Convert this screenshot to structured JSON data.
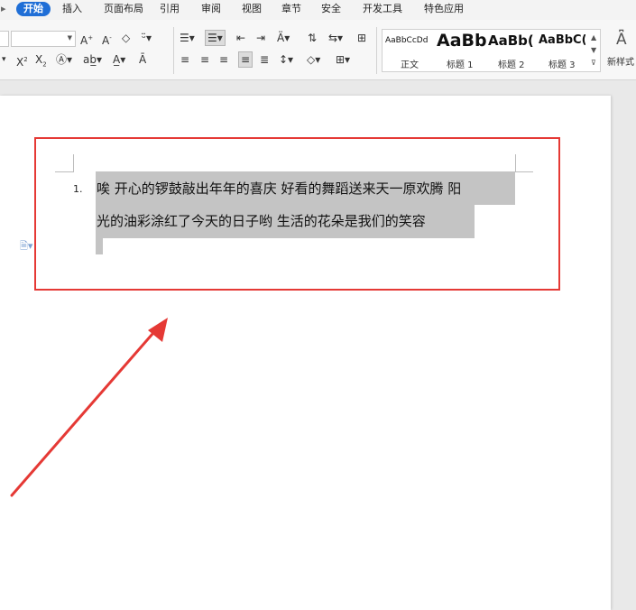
{
  "menu_tabs": [
    {
      "label": "开始",
      "active": true
    },
    {
      "label": "插入"
    },
    {
      "label": "页面布局"
    },
    {
      "label": "引用"
    },
    {
      "label": "审阅"
    },
    {
      "label": "视图"
    },
    {
      "label": "章节"
    },
    {
      "label": "安全"
    },
    {
      "label": "开发工具"
    },
    {
      "label": "特色应用"
    }
  ],
  "accent_color": "#1f6ed6",
  "annotation_color": "#e53935",
  "styles_gallery": [
    {
      "sample": "AaBbCcDd",
      "name": "正文"
    },
    {
      "sample": "AaBb",
      "name": "标题 1"
    },
    {
      "sample": "AaBb(",
      "name": "标题 2"
    },
    {
      "sample": "AaBbC(",
      "name": "标题 3"
    }
  ],
  "new_style_label": "新样式",
  "document": {
    "list_number": "1.",
    "line1": "唉  开心的锣鼓敲出年年的喜庆  好看的舞蹈送来天一原欢腾  阳",
    "line2": "光的油彩涂红了今天的日子哟  生活的花朵是我们的笑容"
  }
}
